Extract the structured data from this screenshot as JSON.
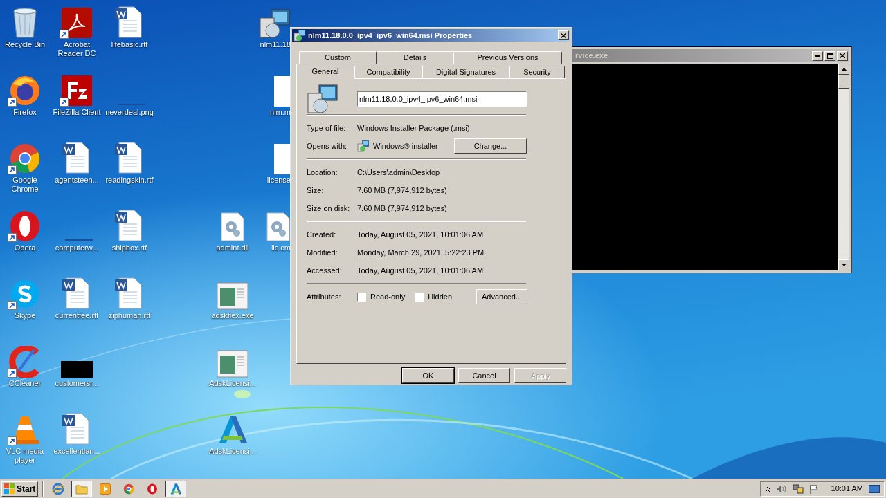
{
  "desktop_icons": [
    {
      "label": "Recycle Bin",
      "kind": "recycle",
      "shortcut": false
    },
    {
      "label": "Firefox",
      "kind": "firefox",
      "shortcut": true
    },
    {
      "label": "Google Chrome",
      "kind": "chrome",
      "shortcut": true
    },
    {
      "label": "Opera",
      "kind": "opera",
      "shortcut": true
    },
    {
      "label": "Skype",
      "kind": "skype",
      "shortcut": true
    },
    {
      "label": "CCleaner",
      "kind": "ccleaner",
      "shortcut": true
    },
    {
      "label": "VLC media player",
      "kind": "vlc",
      "shortcut": true
    },
    {
      "label": "Acrobat Reader DC",
      "kind": "acrobat",
      "shortcut": true
    },
    {
      "label": "FileZilla Client",
      "kind": "filezilla",
      "shortcut": true
    },
    {
      "label": "agentsteen...",
      "kind": "word",
      "shortcut": false
    },
    {
      "label": "computerw...",
      "kind": "blank",
      "shortcut": false
    },
    {
      "label": "currentfee.rtf",
      "kind": "word",
      "shortcut": false
    },
    {
      "label": "customersr...",
      "kind": "black",
      "shortcut": false
    },
    {
      "label": "excellentlan...",
      "kind": "word",
      "shortcut": false
    },
    {
      "label": "lifebasic.rtf",
      "kind": "word",
      "shortcut": false
    },
    {
      "label": "neverdeal.png",
      "kind": "blank",
      "shortcut": false
    },
    {
      "label": "readingskin.rtf",
      "kind": "word",
      "shortcut": false
    },
    {
      "label": "shipbox.rtf",
      "kind": "word",
      "shortcut": false
    },
    {
      "label": "ziphuman.rtf",
      "kind": "word",
      "shortcut": false
    },
    {
      "label": "admint.dll",
      "kind": "gearfile",
      "shortcut": false
    },
    {
      "label": "adskflex.exe",
      "kind": "appwindow",
      "shortcut": false
    },
    {
      "label": "AdskLicensi...",
      "kind": "appwindow",
      "shortcut": false
    },
    {
      "label": "AdskLicensi...",
      "kind": "autodesk",
      "shortcut": false
    },
    {
      "label": "nlm11.18",
      "kind": "installer",
      "shortcut": false
    },
    {
      "label": "nlm.m",
      "kind": "page",
      "shortcut": false
    },
    {
      "label": "license",
      "kind": "page",
      "shortcut": false
    },
    {
      "label": "lic.cm",
      "kind": "gearfile",
      "shortcut": false
    }
  ],
  "console_window": {
    "title": "rvice.exe"
  },
  "dialog": {
    "title": "nlm11.18.0.0_ipv4_ipv6_win64.msi Properties",
    "tabs_back": [
      {
        "label": "Custom",
        "selected": false
      },
      {
        "label": "Details",
        "selected": false
      },
      {
        "label": "Previous Versions",
        "selected": false
      }
    ],
    "tabs_front": [
      {
        "label": "General",
        "selected": true
      },
      {
        "label": "Compatibility",
        "selected": false
      },
      {
        "label": "Digital Signatures",
        "selected": false
      },
      {
        "label": "Security",
        "selected": false
      }
    ],
    "file_name": "nlm11.18.0.0_ipv4_ipv6_win64.msi",
    "sections": [
      [
        {
          "kind": "text",
          "label": "Type of file:",
          "value": "Windows Installer Package (.msi)"
        },
        {
          "kind": "opens_with",
          "label": "Opens with:",
          "value": "Windows® installer",
          "button": "Change..."
        }
      ],
      [
        {
          "kind": "text",
          "label": "Location:",
          "value": "C:\\Users\\admin\\Desktop"
        },
        {
          "kind": "text",
          "label": "Size:",
          "value": "7.60 MB (7,974,912 bytes)"
        },
        {
          "kind": "text",
          "label": "Size on disk:",
          "value": "7.60 MB (7,974,912 bytes)"
        }
      ],
      [
        {
          "kind": "text",
          "label": "Created:",
          "value": "Today, August 05, 2021, 10:01:06 AM"
        },
        {
          "kind": "text",
          "label": "Modified:",
          "value": "Monday, March 29, 2021, 5:22:23 PM"
        },
        {
          "kind": "text",
          "label": "Accessed:",
          "value": "Today, August 05, 2021, 10:01:06 AM"
        }
      ],
      [
        {
          "kind": "attributes",
          "label": "Attributes:",
          "checkboxes": [
            {
              "label": "Read-only",
              "checked": false
            },
            {
              "label": "Hidden",
              "checked": false
            }
          ],
          "button": "Advanced..."
        }
      ]
    ],
    "buttons": [
      {
        "label": "OK",
        "disabled": false
      },
      {
        "label": "Cancel",
        "disabled": false
      },
      {
        "label": "Apply",
        "disabled": true
      }
    ]
  },
  "taskbar": {
    "start": "Start",
    "apps": [
      {
        "kind": "ie",
        "selected": false
      },
      {
        "kind": "explorer",
        "selected": true
      },
      {
        "kind": "media",
        "selected": false
      },
      {
        "kind": "chrome",
        "selected": false
      },
      {
        "kind": "opera",
        "selected": false
      },
      {
        "kind": "autodesk",
        "selected": true
      }
    ],
    "clock": "10:01 AM"
  }
}
